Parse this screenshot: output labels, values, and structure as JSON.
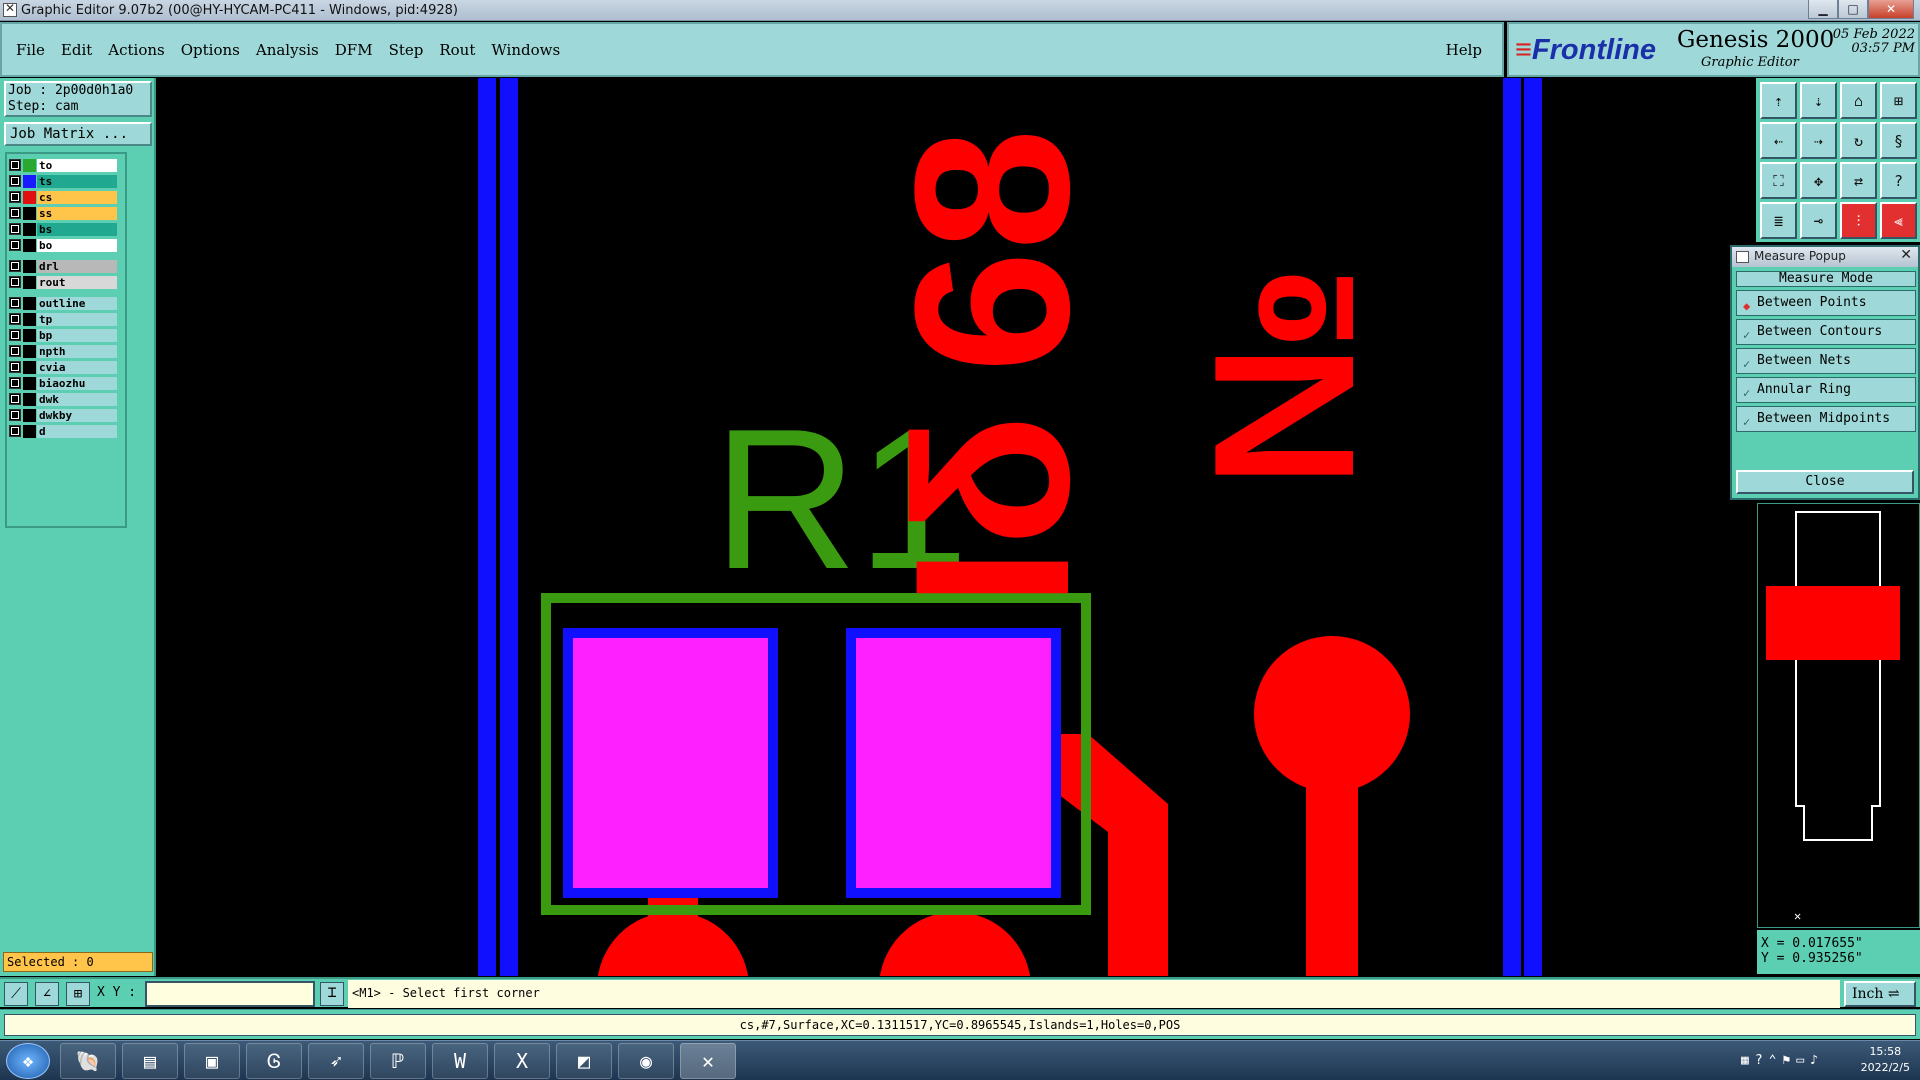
{
  "window": {
    "title": "Graphic Editor 9.07b2 (00@HY-HYCAM-PC411 - Windows, pid:4928)"
  },
  "menu": {
    "items": [
      "File",
      "Edit",
      "Actions",
      "Options",
      "Analysis",
      "DFM",
      "Step",
      "Rout",
      "Windows"
    ],
    "help": "Help"
  },
  "brand": {
    "logo": "Frontline",
    "product": "Genesis 2000",
    "subtitle": "Graphic Editor",
    "date": "05 Feb 2022",
    "time": "03:57 PM"
  },
  "job": {
    "job_line": "Job : 2p00d0h1a0",
    "step_line": "Step: cam",
    "matrix_button": "Job Matrix ..."
  },
  "layers": [
    {
      "name": "to",
      "color": "#2aa830",
      "bg": "#ffffff"
    },
    {
      "name": "ts",
      "color": "#1a1aff",
      "bg": "#20a890"
    },
    {
      "name": "cs",
      "color": "#e01010",
      "bg": "#ffc44a"
    },
    {
      "name": "ss",
      "color": "#000000",
      "bg": "#ffc44a"
    },
    {
      "name": "bs",
      "color": "#000000",
      "bg": "#20a890"
    },
    {
      "name": "bo",
      "color": "#000000",
      "bg": "#ffffff"
    },
    {
      "name": "drl",
      "color": "#000000",
      "bg": "#b8b8b8"
    },
    {
      "name": "rout",
      "color": "#000000",
      "bg": "#d8d8d8"
    },
    {
      "name": "outline",
      "color": "#000000",
      "bg": "#9fd8d8"
    },
    {
      "name": "tp",
      "color": "#000000",
      "bg": "#9fd8d8"
    },
    {
      "name": "bp",
      "color": "#000000",
      "bg": "#9fd8d8"
    },
    {
      "name": "npth",
      "color": "#000000",
      "bg": "#9fd8d8"
    },
    {
      "name": "cvia",
      "color": "#000000",
      "bg": "#9fd8d8"
    },
    {
      "name": "biaozhu",
      "color": "#000000",
      "bg": "#9fd8d8"
    },
    {
      "name": "dwk",
      "color": "#000000",
      "bg": "#9fd8d8"
    },
    {
      "name": "dwkby",
      "color": "#000000",
      "bg": "#9fd8d8"
    },
    {
      "name": "d",
      "color": "#000000",
      "bg": "#9fd8d8"
    }
  ],
  "selected": "Selected : 0",
  "canvas": {
    "silk_text": "R1",
    "copper_text_1": "68",
    "copper_text_2": "Ιδ",
    "copper_text_3": "№"
  },
  "measure": {
    "title": "Measure Popup",
    "header": "Measure Mode",
    "options": [
      "Between Points",
      "Between Contours",
      "Between Nets",
      "Annular Ring",
      "Between Midpoints"
    ],
    "active": "Between Points",
    "close": "Close"
  },
  "coords": {
    "x": "X = 0.017655\"",
    "y": "Y = 0.935256\""
  },
  "bottom": {
    "xy_label": "X Y :",
    "xy_value": "",
    "prompt": "<M1> - Select first corner",
    "unit": "Inch"
  },
  "status": "cs,#7,Surface,XC=0.1311517,YC=0.8965545,Islands=1,Holes=0,POS",
  "tray": {
    "time": "15:58",
    "date": "2022/2/5"
  },
  "colors": {
    "panel": "#5ccfb2",
    "menubar": "#9fd8d8",
    "copper": "#ff0000",
    "silk": "#3a9a10",
    "pad": "#ff20ff",
    "solder": "#1010ff"
  }
}
